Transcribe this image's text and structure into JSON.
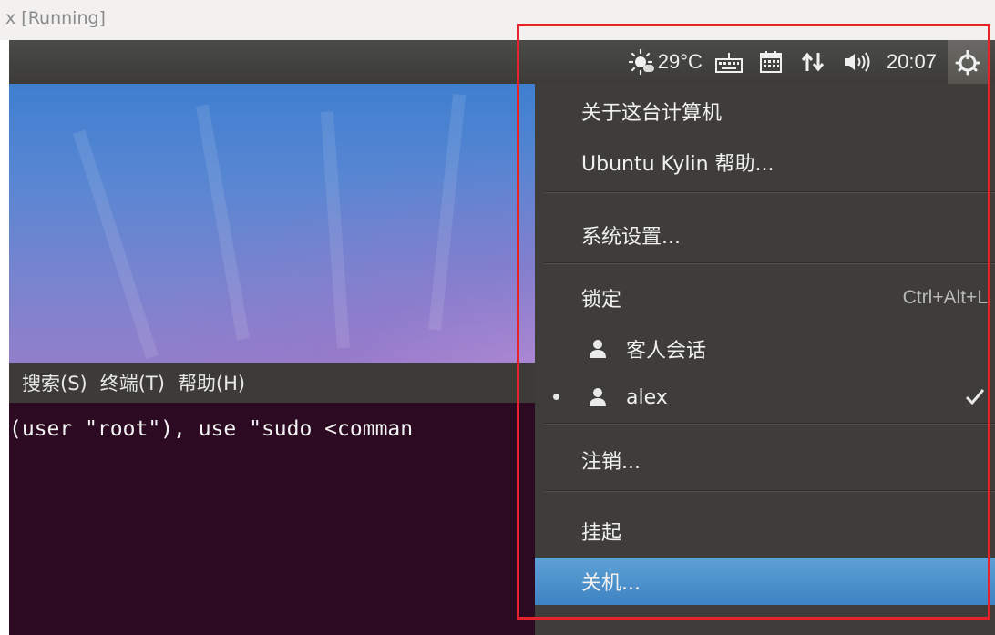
{
  "host_window": {
    "title": "x [Running]"
  },
  "top_panel": {
    "weather_temp": "29°C",
    "clock": "20:07",
    "indicators": [
      "weather-icon",
      "keyboard-icon",
      "calendar-icon",
      "network-icon",
      "volume-icon",
      "power-icon"
    ]
  },
  "terminal": {
    "menus": [
      "搜索(S)",
      "终端(T)",
      "帮助(H)"
    ],
    "line": "(user \"root\"), use \"sudo <comman"
  },
  "session_menu": {
    "items": [
      {
        "label": "关于这台计算机"
      },
      {
        "label": "Ubuntu Kylin 帮助..."
      },
      {
        "label": "系统设置..."
      },
      {
        "label": "锁定",
        "accel": "Ctrl+Alt+L"
      },
      {
        "label": "客人会话"
      },
      {
        "label": "alex"
      },
      {
        "label": "注销..."
      },
      {
        "label": "挂起"
      },
      {
        "label": "关机..."
      }
    ],
    "active_user": "alex",
    "highlighted_item": "关机...",
    "accent_color": "#4a90cf"
  },
  "annotation": {
    "highlight_color": "#e8222a"
  }
}
